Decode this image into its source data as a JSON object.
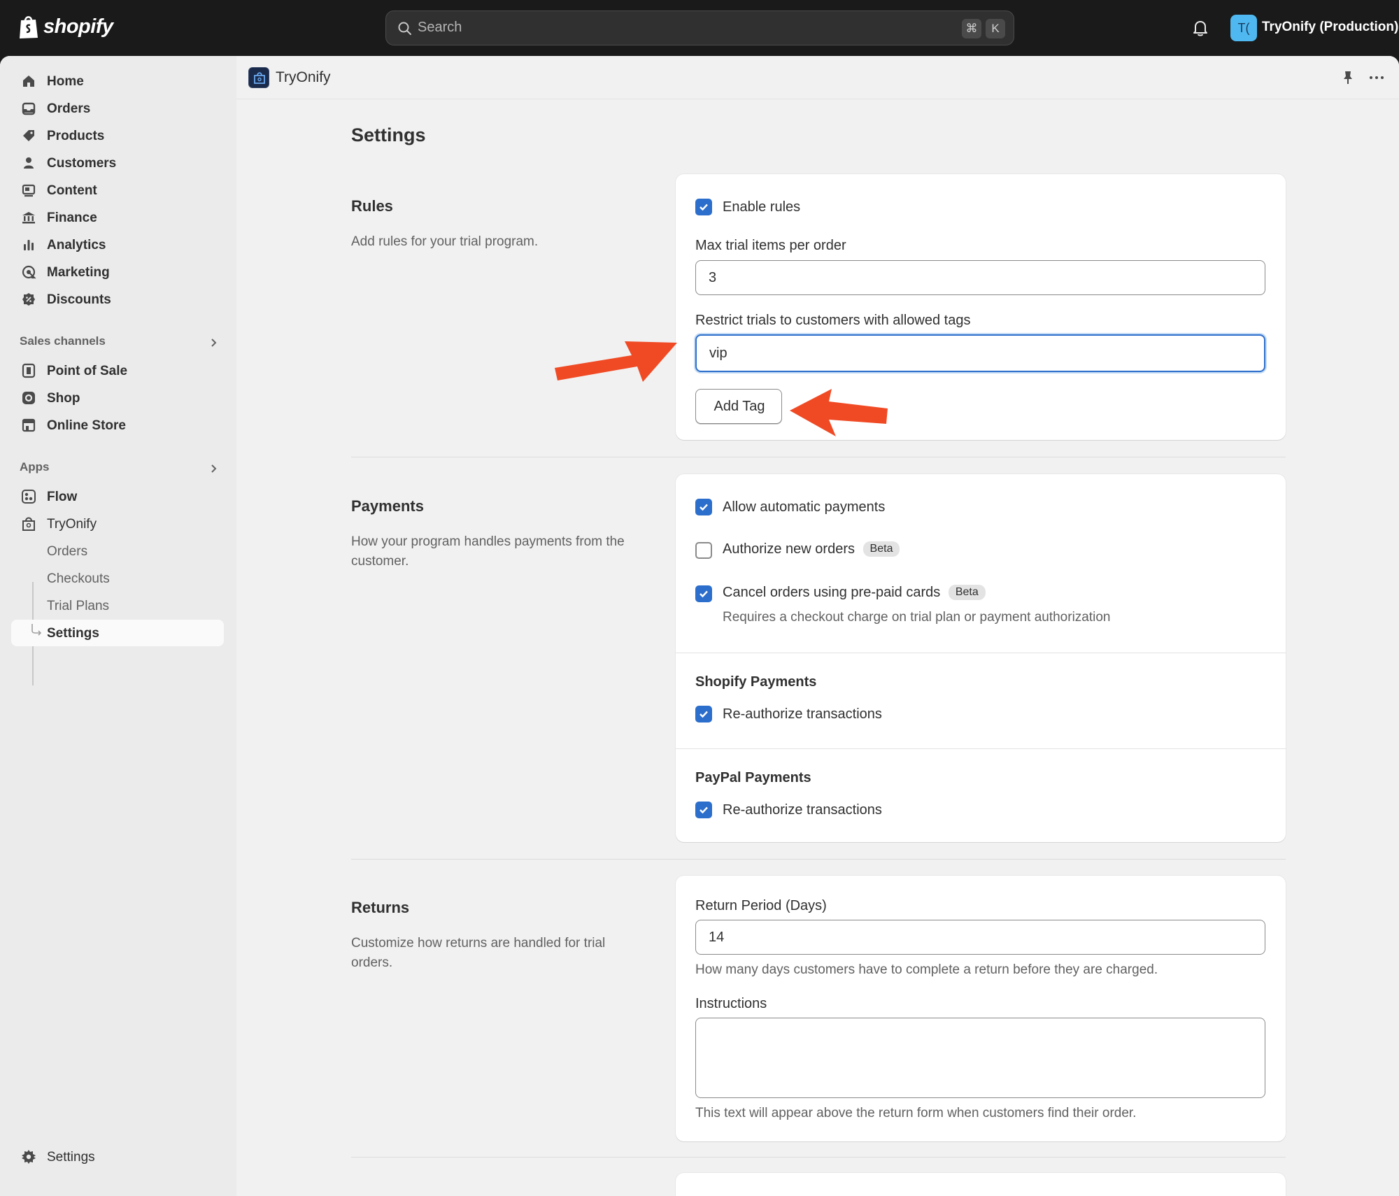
{
  "topbar": {
    "logo_text": "shopify",
    "search_placeholder": "Search",
    "shortcut_keys": [
      "⌘",
      "K"
    ],
    "account_initials": "T(",
    "account_name": "TryOnify (Production)",
    "account_color": "#4fb8f0"
  },
  "sidebar": {
    "main_items": [
      {
        "label": "Home",
        "icon": "home-icon"
      },
      {
        "label": "Orders",
        "icon": "orders-icon"
      },
      {
        "label": "Products",
        "icon": "tag-icon"
      },
      {
        "label": "Customers",
        "icon": "person-icon"
      },
      {
        "label": "Content",
        "icon": "content-icon"
      },
      {
        "label": "Finance",
        "icon": "bank-icon"
      },
      {
        "label": "Analytics",
        "icon": "bar-chart-icon"
      },
      {
        "label": "Marketing",
        "icon": "target-icon"
      },
      {
        "label": "Discounts",
        "icon": "discount-icon"
      }
    ],
    "sales_channels_label": "Sales channels",
    "sales_channels": [
      {
        "label": "Point of Sale",
        "icon": "pos-icon"
      },
      {
        "label": "Shop",
        "icon": "shop-icon"
      },
      {
        "label": "Online Store",
        "icon": "store-icon"
      }
    ],
    "apps_label": "Apps",
    "apps": [
      {
        "label": "Flow",
        "icon": "flow-icon"
      },
      {
        "label": "TryOnify",
        "icon": "bag-icon"
      }
    ],
    "tryonify_subitems": [
      {
        "label": "Orders"
      },
      {
        "label": "Checkouts"
      },
      {
        "label": "Trial Plans"
      },
      {
        "label": "Settings",
        "active": true
      }
    ],
    "settings_label": "Settings"
  },
  "header": {
    "app_name": "TryOnify"
  },
  "page": {
    "title": "Settings",
    "rules": {
      "title": "Rules",
      "description": "Add rules for your trial program.",
      "enable_rules_label": "Enable rules",
      "enable_rules_checked": true,
      "max_items_label": "Max trial items per order",
      "max_items_value": "3",
      "tags_label": "Restrict trials to customers with allowed tags",
      "tags_value": "vip",
      "add_tag_label": "Add Tag"
    },
    "payments": {
      "title": "Payments",
      "description": "How your program handles payments from the customer.",
      "allow_auto_label": "Allow automatic payments",
      "allow_auto_checked": true,
      "authorize_label": "Authorize new orders",
      "authorize_checked": false,
      "authorize_badge": "Beta",
      "cancel_label": "Cancel orders using pre-paid cards",
      "cancel_checked": true,
      "cancel_badge": "Beta",
      "cancel_help": "Requires a checkout charge on trial plan or payment authorization",
      "shopify_heading": "Shopify Payments",
      "shopify_reauth_label": "Re-authorize transactions",
      "shopify_reauth_checked": true,
      "paypal_heading": "PayPal Payments",
      "paypal_reauth_label": "Re-authorize transactions",
      "paypal_reauth_checked": true
    },
    "returns": {
      "title": "Returns",
      "description": "Customize how returns are handled for trial orders.",
      "period_label": "Return Period (Days)",
      "period_value": "14",
      "period_help": "How many days customers have to complete a return before they are charged.",
      "instructions_label": "Instructions",
      "instructions_value": "",
      "instructions_help": "This text will appear above the return form when customers find their order."
    }
  },
  "colors": {
    "accent": "#2c6ecb",
    "annotation_arrow": "#f04a24"
  }
}
